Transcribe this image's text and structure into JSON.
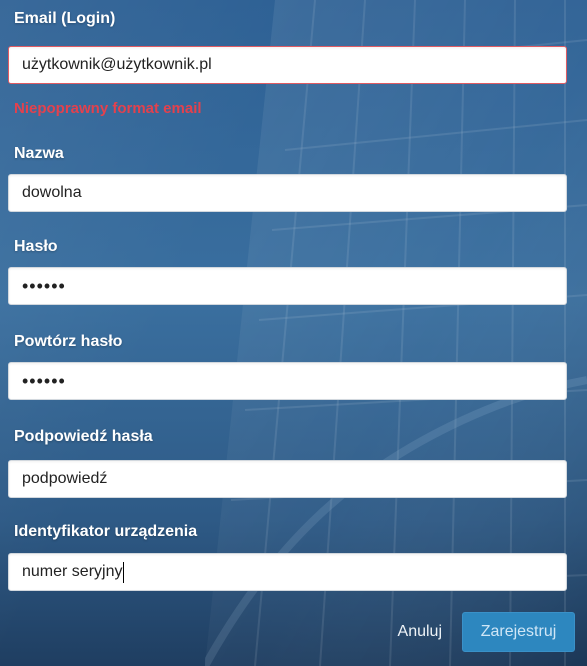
{
  "form": {
    "email_label": "Email (Login)",
    "email_value": "użytkownik@użytkownik.pl",
    "email_error": "Niepoprawny format email",
    "name_label": "Nazwa",
    "name_value": "dowolna",
    "password_label": "Hasło",
    "password_value": "••••••",
    "repeat_password_label": "Powtórz hasło",
    "repeat_password_value": "••••••",
    "hint_label": "Podpowiedź hasła",
    "hint_value": "podpowiedź",
    "device_id_label": "Identyfikator urządzenia",
    "device_id_value": "numer seryjny"
  },
  "actions": {
    "cancel_label": "Anuluj",
    "register_label": "Zarejestruj"
  },
  "colors": {
    "error": "#e3414d",
    "primary_button": "#2d87bf",
    "background": "#2f5f8f"
  }
}
